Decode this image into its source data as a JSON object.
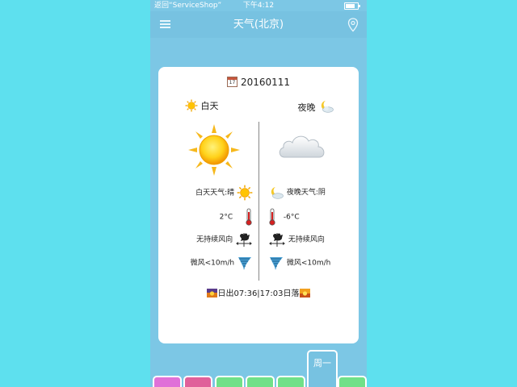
{
  "status_bar": {
    "back_label": "返回“ServiceShop”",
    "time": "下午4:12"
  },
  "navbar": {
    "title": "天气(北京)",
    "menu_icon": "menu-icon",
    "location_icon": "location-pin-icon"
  },
  "card": {
    "date": "20160111",
    "day_label": "白天",
    "night_label": "夜晚",
    "day": {
      "weather": "白天天气:晴",
      "temperature": "2°C",
      "wind_direction": "无持续风向",
      "wind_speed": "微风<10m/h"
    },
    "night": {
      "weather": "夜晚天气:阴",
      "temperature": "-6°C",
      "wind_direction": "无持续风向",
      "wind_speed": "微风<10m/h"
    },
    "sun_times": "日出07:36|17:03日落"
  },
  "tabs": {
    "active_label": "周一",
    "colors": [
      "#e070d8",
      "#e0609a",
      "#70e088",
      "#70e088",
      "#70e088",
      "#70e088"
    ]
  },
  "colors": {
    "background": "#5ee0ee",
    "header": "#77c2e1",
    "phone_bg": "#7cc7e5",
    "card": "#ffffff"
  }
}
